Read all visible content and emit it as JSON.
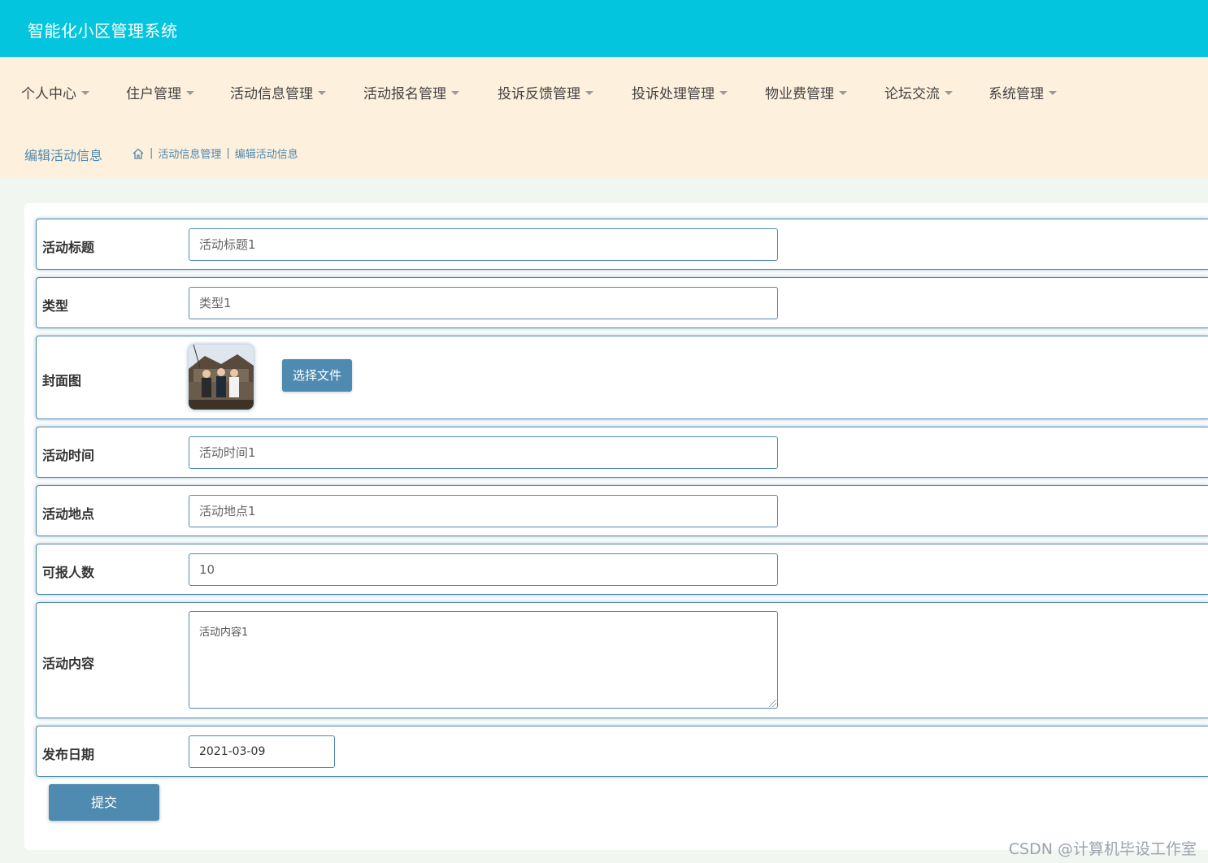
{
  "app": {
    "title": "智能化小区管理系统"
  },
  "nav": {
    "items": [
      {
        "label": "个人中心"
      },
      {
        "label": "住户管理"
      },
      {
        "label": "活动信息管理"
      },
      {
        "label": "活动报名管理"
      },
      {
        "label": "投诉反馈管理"
      },
      {
        "label": "投诉处理管理"
      },
      {
        "label": "物业费管理"
      },
      {
        "label": "论坛交流"
      },
      {
        "label": "系统管理"
      }
    ]
  },
  "breadcrumb": {
    "page_title": "编辑活动信息",
    "items": [
      "活动信息管理",
      "编辑活动信息"
    ]
  },
  "form": {
    "title": {
      "label": "活动标题",
      "value": "活动标题1"
    },
    "type": {
      "label": "类型",
      "value": "类型1"
    },
    "cover": {
      "label": "封面图",
      "button": "选择文件"
    },
    "time": {
      "label": "活动时间",
      "value": "活动时间1"
    },
    "location": {
      "label": "活动地点",
      "value": "活动地点1"
    },
    "capacity": {
      "label": "可报人数",
      "value": "10"
    },
    "content": {
      "label": "活动内容",
      "value": "活动内容1"
    },
    "publish_date": {
      "label": "发布日期",
      "value": "2021-03-09"
    },
    "submit": "提交"
  },
  "watermark": "CSDN @计算机毕设工作室",
  "colors": {
    "header": "#03c5de",
    "nav_bg": "#fdf0dc",
    "accent": "#4f8ab0",
    "page_bg": "#f2f6f0"
  }
}
